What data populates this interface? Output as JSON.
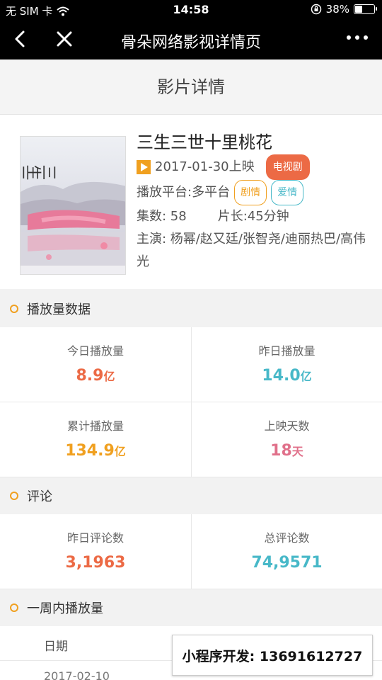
{
  "status_bar": {
    "carrier": "无 SIM 卡",
    "time": "14:58",
    "battery": "38%",
    "battery_level": 0.38,
    "icons": [
      "wifi-icon",
      "orientation-lock-icon",
      "battery-icon"
    ]
  },
  "nav": {
    "title": "骨朵网络影视详情页",
    "icons": [
      "back-icon",
      "close-icon",
      "more-icon"
    ]
  },
  "page_heading": "影片详情",
  "film": {
    "title": "三生三世十里桃花",
    "release": "2017-01-30上映",
    "category_tag": "电视剧",
    "platform": "播放平台:多平台",
    "genre_tags": [
      "剧情",
      "爱情"
    ],
    "episodes": "集数: 58",
    "duration": "片长:45分钟",
    "cast": "主演: 杨幂/赵又廷/张智尧/迪丽热巴/高伟光",
    "poster_text": "三生三世十里桃花"
  },
  "play_section": {
    "title": "播放量数据",
    "stats": [
      {
        "label": "今日播放量",
        "value": "8.9",
        "unit": "亿",
        "color": "#ec6a45"
      },
      {
        "label": "昨日播放量",
        "value": "14.0",
        "unit": "亿",
        "color": "#47b8c8"
      },
      {
        "label": "累计播放量",
        "value": "134.9",
        "unit": "亿",
        "color": "#f0a020"
      },
      {
        "label": "上映天数",
        "value": "18",
        "unit": "天",
        "color": "#e0708a"
      }
    ]
  },
  "comment_section": {
    "title": "评论",
    "stats": [
      {
        "label": "昨日评论数",
        "value": "3,1963",
        "color": "#ec6a45"
      },
      {
        "label": "总评论数",
        "value": "74,9571",
        "color": "#47b8c8"
      }
    ]
  },
  "week_section": {
    "title": "一周内播放量",
    "column_date": "日期",
    "first_row_date": "2017-02-10"
  },
  "promo": {
    "text": "小程序开发:  13691612727"
  }
}
